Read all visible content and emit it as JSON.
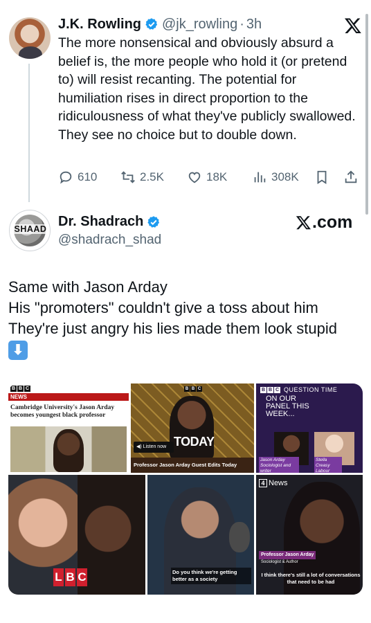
{
  "first_tweet": {
    "author_name": "J.K. Rowling",
    "handle": "@jk_rowling",
    "separator": "·",
    "time": "3h",
    "body": "The more nonsensical and obviously absurd a belief is, the more people who hold it (or pretend to) will resist recanting. The potential for humiliation rises in direct proportion to the ridiculousness of what they've publicly swallowed. They see no choice but to double down.",
    "stats": {
      "replies": "610",
      "reposts": "2.5K",
      "likes": "18K",
      "views": "308K"
    }
  },
  "second_tweet": {
    "author_name": "Dr. Shadrach",
    "handle": "@shadrach_shad",
    "avatar_text": "SHAAD",
    "brand": ".com",
    "lines": [
      "Same with Jason Arday",
      "His \"promoters\" couldn't give a toss about him",
      "They're just angry his lies made them look stupid"
    ],
    "emoji": "⬇"
  },
  "media": {
    "c1": {
      "bbc": [
        "B",
        "B",
        "C"
      ],
      "news": "NEWS",
      "headline": "Cambridge University's Jason Arday becomes youngest black professor"
    },
    "c2": {
      "bbc": [
        "B",
        "B",
        "C"
      ],
      "listen": "Listen now",
      "today": "TODAY",
      "caption": "Professor Jason Arday Guest Edits Today"
    },
    "c3": {
      "bbc": [
        "B",
        "B",
        "C"
      ],
      "show": "QUESTION TIME",
      "panel": "ON OUR PANEL THIS WEEK...",
      "label1": "Jason Arday Sociologist and writer",
      "label2": "Stella Creasy Labour"
    },
    "c4": {
      "lbc": [
        "L",
        "B",
        "C"
      ]
    },
    "c5": {
      "caption": "Do you think we're getting better as a society"
    },
    "c6": {
      "channel": "4",
      "channel_label": "News",
      "name": "Professor Jason Arday",
      "role": "Sociologist & Author",
      "caption": "I think there's still a lot of conversations that need to be had"
    }
  },
  "colors": {
    "verified": "#1d9bf0",
    "muted": "#536471",
    "text": "#0f1419"
  }
}
